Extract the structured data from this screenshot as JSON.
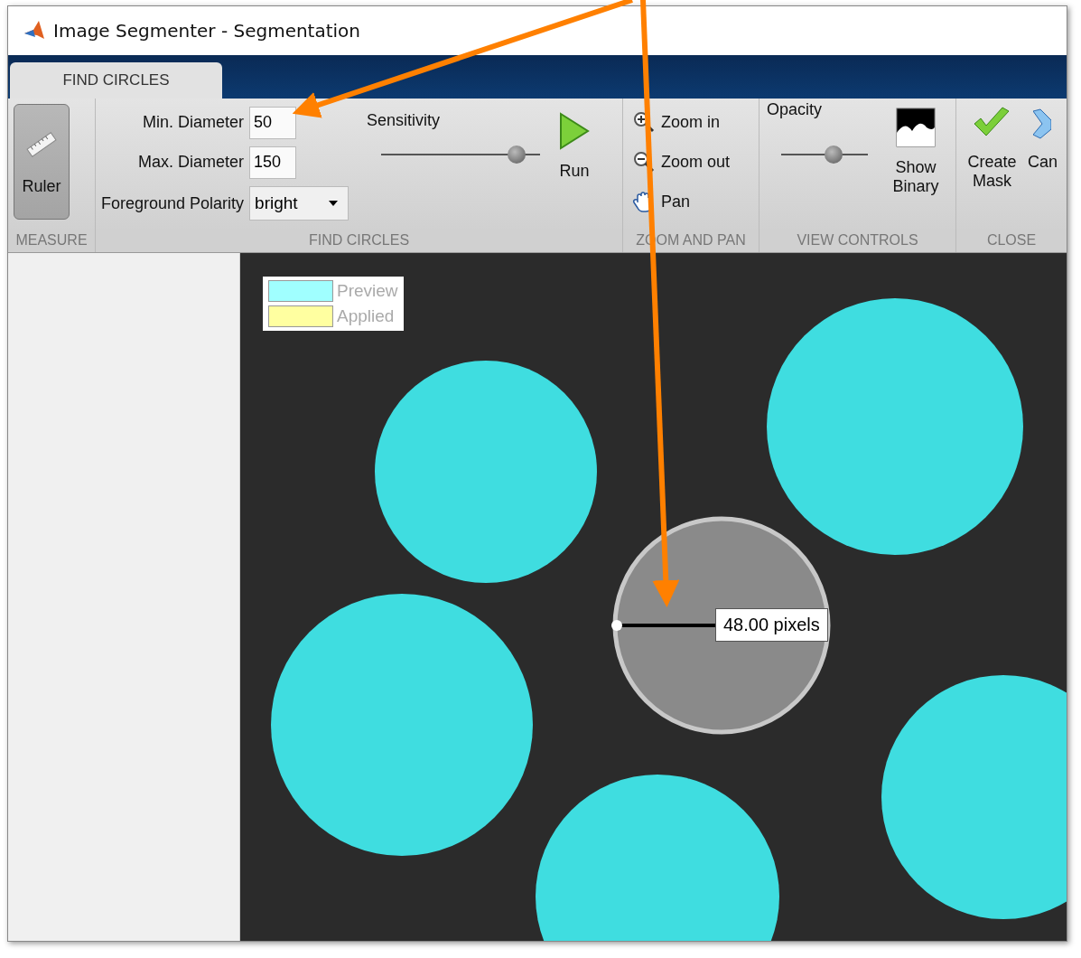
{
  "window": {
    "title": "Image Segmenter - Segmentation"
  },
  "tabs": [
    {
      "label": "FIND CIRCLES",
      "selected": true
    }
  ],
  "measure": {
    "label": "MEASURE",
    "ruler": {
      "label": "Ruler",
      "on": true
    }
  },
  "find_circles": {
    "label": "FIND CIRCLES",
    "fields": [
      {
        "label": "Min. Diameter",
        "value": "50"
      },
      {
        "label": "Max. Diameter",
        "value": "150"
      }
    ],
    "polarity": {
      "label": "Foreground Polarity",
      "value": "bright"
    },
    "sensitivity": {
      "label": "Sensitivity",
      "level": 0.85
    },
    "run": "Run"
  },
  "zoom_and_pan": {
    "label": "ZOOM AND PAN",
    "buttons": [
      {
        "kind": "zoom-in",
        "label": "Zoom in"
      },
      {
        "kind": "zoom-out",
        "label": "Zoom out"
      },
      {
        "kind": "pan",
        "label": "Pan"
      }
    ]
  },
  "view_controls": {
    "label": "VIEW CONTROLS",
    "opacity": {
      "label": "Opacity",
      "level": 0.6
    },
    "show_binary": "Show Binary"
  },
  "close": {
    "label": "CLOSE",
    "buttons": [
      {
        "kind": "create",
        "label": "Create Mask"
      },
      {
        "kind": "cancel",
        "label": "Can"
      }
    ]
  },
  "legend": [
    {
      "label": "Preview",
      "color": "#a0ffff"
    },
    {
      "label": "Applied",
      "color": "#ffffa0"
    }
  ],
  "measurement": {
    "reading": "48.00 pixels"
  }
}
